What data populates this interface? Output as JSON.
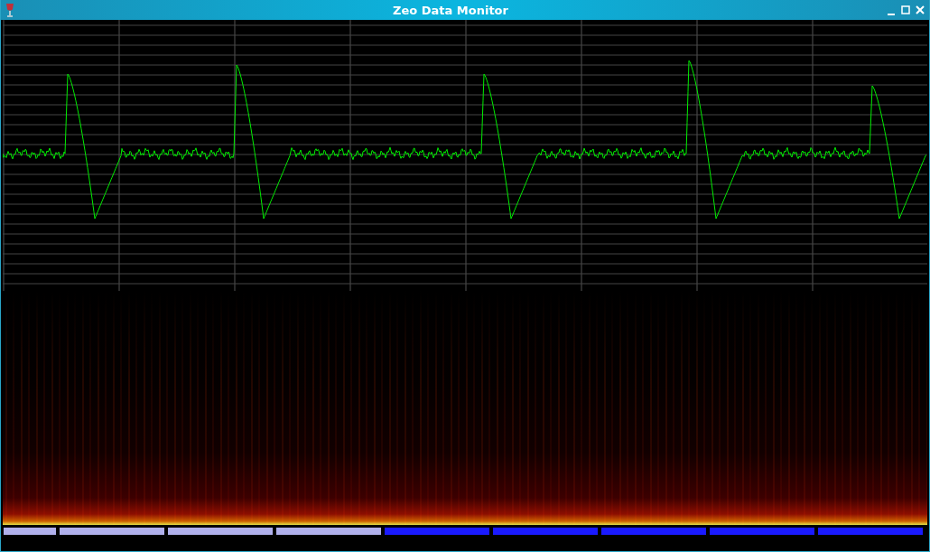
{
  "window": {
    "title": "Zeo Data Monitor"
  },
  "stage_segments": [
    {
      "color": "#b0b0ec"
    },
    {
      "color": "#b0b0ec"
    },
    {
      "color": "#b0b0ec"
    },
    {
      "color": "#b0b0ec"
    },
    {
      "color": "#1a1aff"
    },
    {
      "color": "#1a1aff"
    },
    {
      "color": "#1a1aff"
    },
    {
      "color": "#1a1aff"
    },
    {
      "color": "#1a1aff"
    }
  ]
}
